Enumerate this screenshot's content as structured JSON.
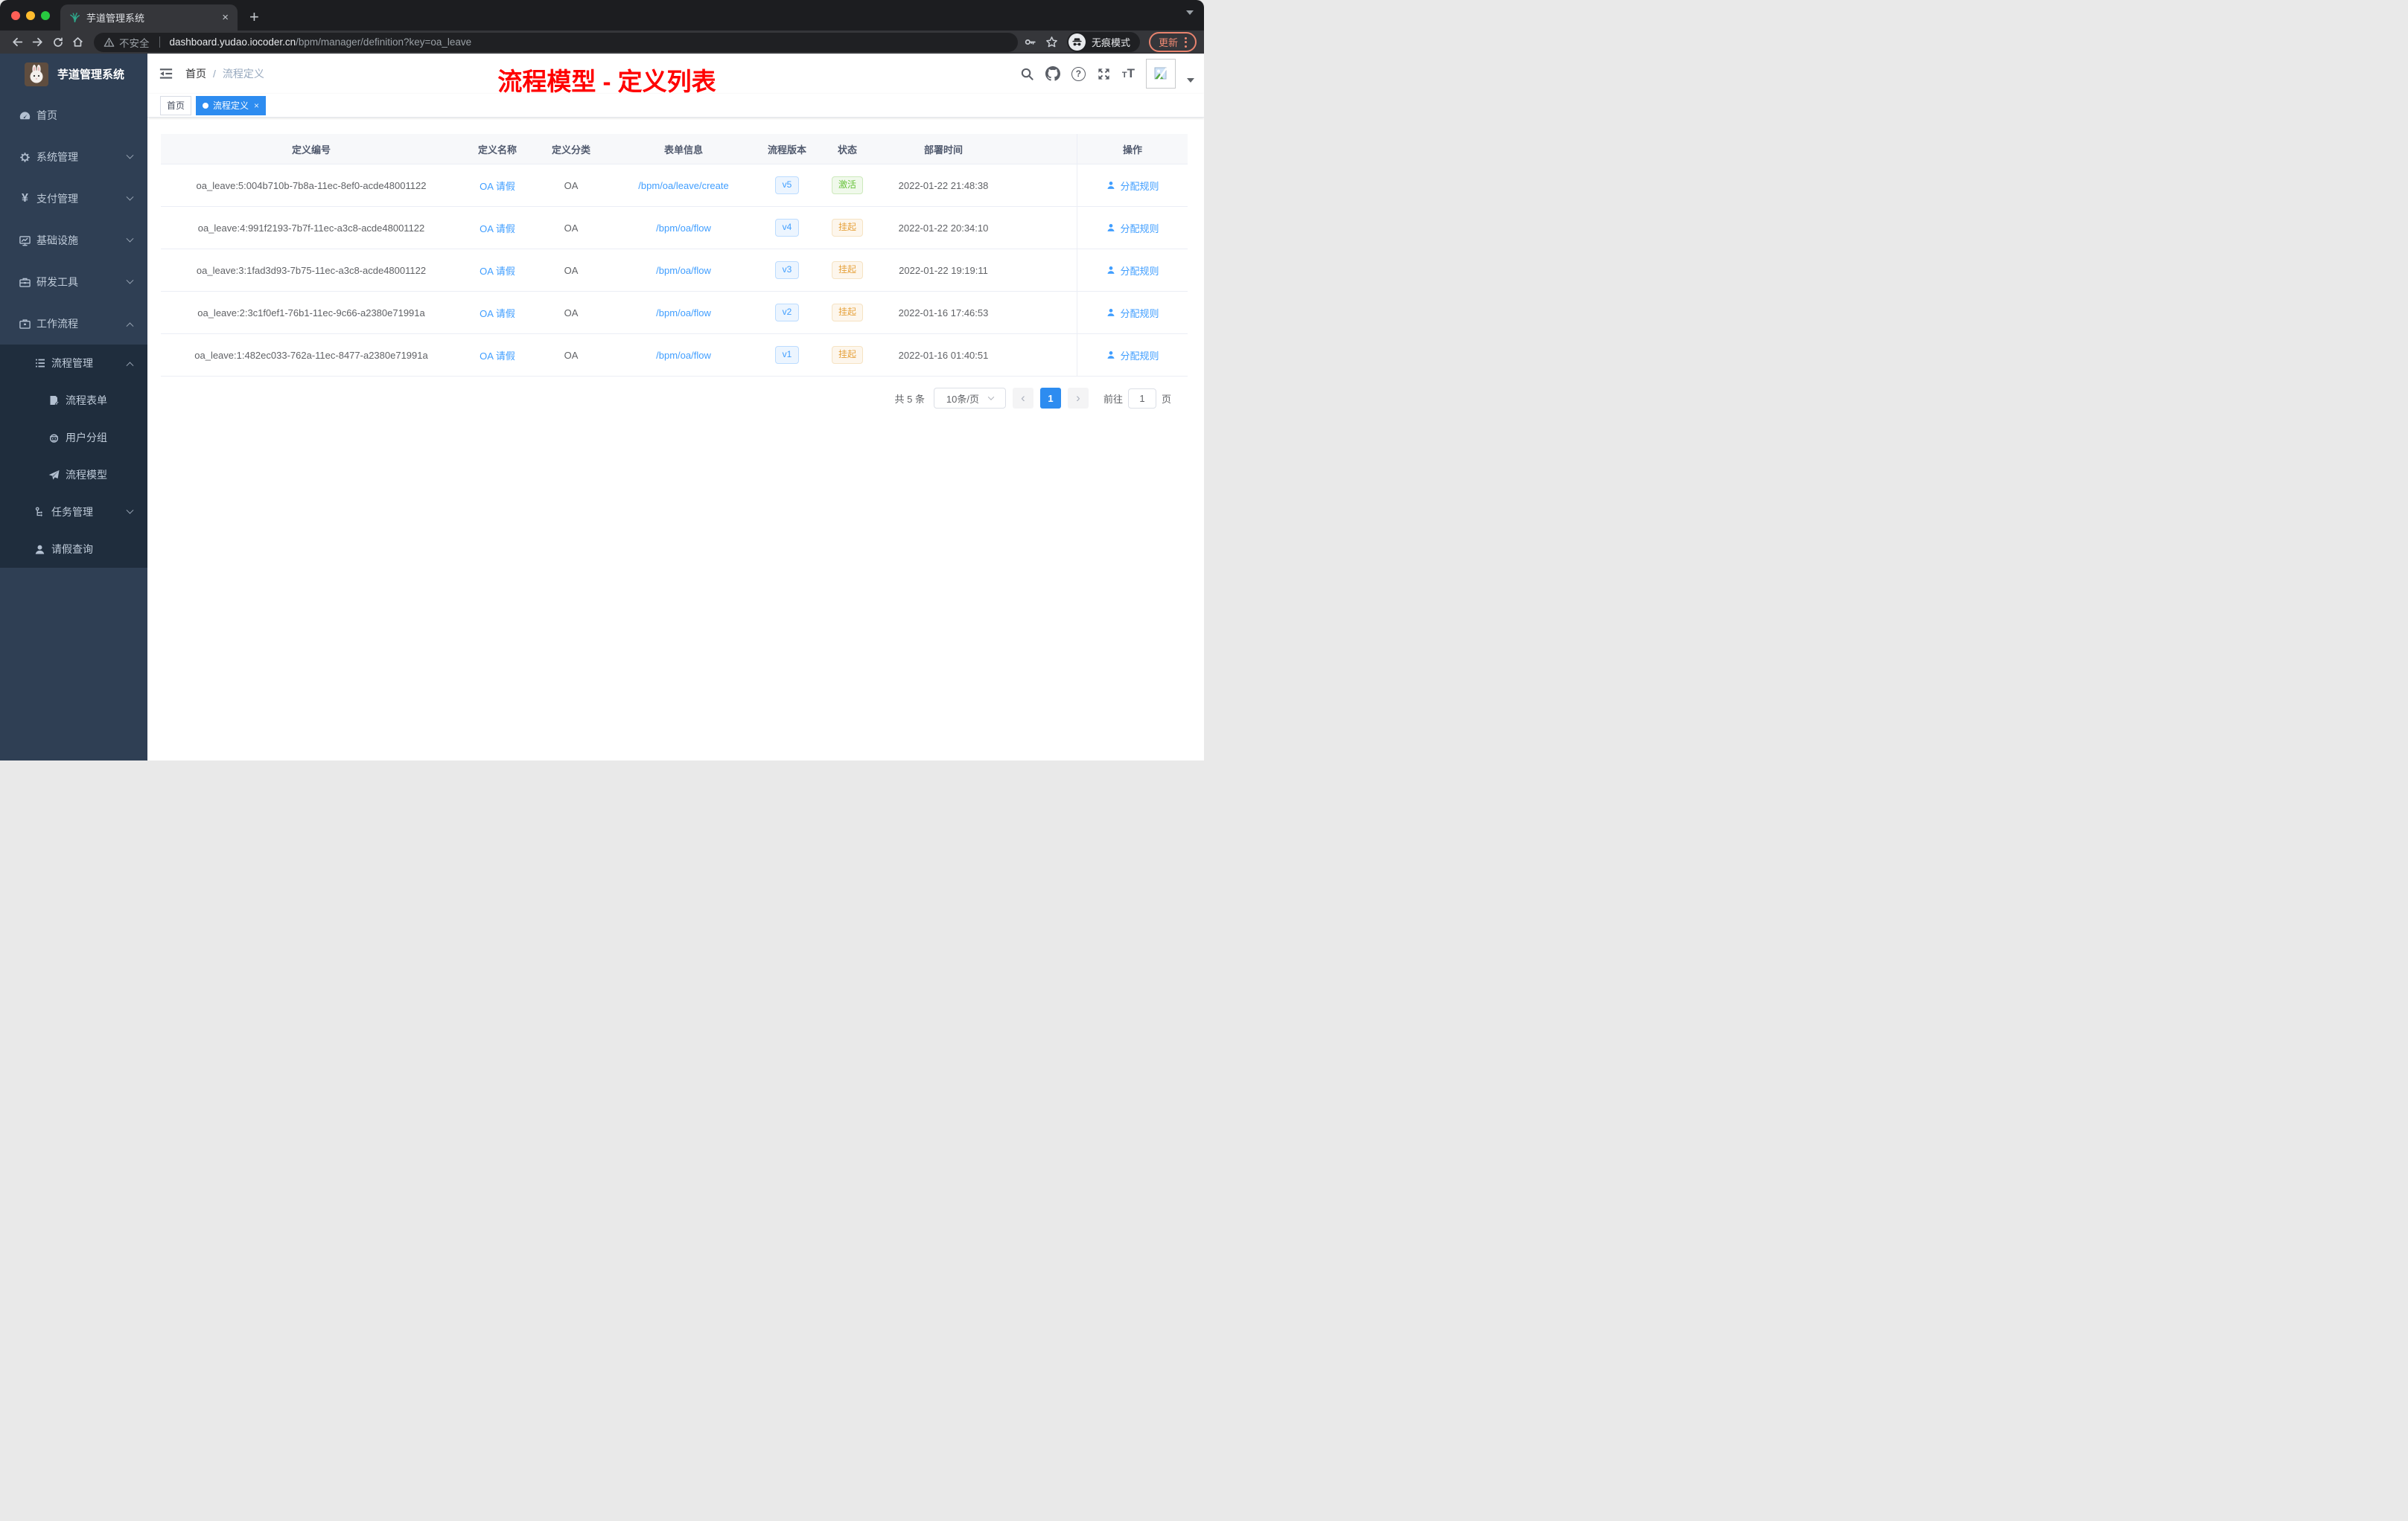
{
  "colors": {
    "accent": "#409eff",
    "tag_active": "#2d8cf0",
    "success": "#67c23a",
    "warning": "#e6a23c",
    "annotation": "#ff0000",
    "sidebar_bg": "#2f3f54",
    "submenu_bg": "#1f2d3d"
  },
  "browser": {
    "tab_title": "芋道管理系统",
    "close_tab": "×",
    "new_tab": "+",
    "not_secure": "不安全",
    "url_host": "dashboard.yudao.iocoder.cn",
    "url_path": "/bpm/manager/definition?key=oa_leave",
    "incognito": "无痕模式",
    "update": "更新"
  },
  "sidebar": {
    "app_title": "芋道管理系统",
    "items": [
      {
        "label": "首页",
        "icon": "dashboard-icon"
      },
      {
        "label": "系统管理",
        "icon": "gear-icon"
      },
      {
        "label": "支付管理",
        "icon": "yen-icon"
      },
      {
        "label": "基础设施",
        "icon": "monitor-icon"
      },
      {
        "label": "研发工具",
        "icon": "toolbox-icon"
      },
      {
        "label": "工作流程",
        "icon": "briefcase-icon"
      }
    ],
    "submenu": [
      {
        "label": "流程管理",
        "icon": "list-icon"
      },
      {
        "label": "流程表单",
        "icon": "form-icon"
      },
      {
        "label": "用户分组",
        "icon": "robot-icon"
      },
      {
        "label": "流程模型",
        "icon": "paper-plane-icon"
      },
      {
        "label": "任务管理",
        "icon": "tree-icon"
      },
      {
        "label": "请假查询",
        "icon": "user-icon"
      }
    ]
  },
  "header": {
    "breadcrumb_home": "首页",
    "breadcrumb_sep": "/",
    "breadcrumb_current": "流程定义",
    "annotation": "流程模型 - 定义列表"
  },
  "tags": [
    {
      "label": "首页",
      "active": false
    },
    {
      "label": "流程定义",
      "active": true,
      "close": "×"
    }
  ],
  "table": {
    "columns": [
      "定义编号",
      "定义名称",
      "定义分类",
      "表单信息",
      "流程版本",
      "状态",
      "部署时间",
      "操作"
    ],
    "rows": [
      {
        "id": "oa_leave:5:004b710b-7b8a-11ec-8ef0-acde48001122",
        "name": "OA 请假",
        "category": "OA",
        "form": "/bpm/oa/leave/create",
        "version": "v5",
        "status": "激活",
        "status_type": "success",
        "time": "2022-01-22 21:48:38",
        "action": "分配规则"
      },
      {
        "id": "oa_leave:4:991f2193-7b7f-11ec-a3c8-acde48001122",
        "name": "OA 请假",
        "category": "OA",
        "form": "/bpm/oa/flow",
        "version": "v4",
        "status": "挂起",
        "status_type": "warning",
        "time": "2022-01-22 20:34:10",
        "action": "分配规则"
      },
      {
        "id": "oa_leave:3:1fad3d93-7b75-11ec-a3c8-acde48001122",
        "name": "OA 请假",
        "category": "OA",
        "form": "/bpm/oa/flow",
        "version": "v3",
        "status": "挂起",
        "status_type": "warning",
        "time": "2022-01-22 19:19:11",
        "action": "分配规则"
      },
      {
        "id": "oa_leave:2:3c1f0ef1-76b1-11ec-9c66-a2380e71991a",
        "name": "OA 请假",
        "category": "OA",
        "form": "/bpm/oa/flow",
        "version": "v2",
        "status": "挂起",
        "status_type": "warning",
        "time": "2022-01-16 17:46:53",
        "action": "分配规则"
      },
      {
        "id": "oa_leave:1:482ec033-762a-11ec-8477-a2380e71991a",
        "name": "OA 请假",
        "category": "OA",
        "form": "/bpm/oa/flow",
        "version": "v1",
        "status": "挂起",
        "status_type": "warning",
        "time": "2022-01-16 01:40:51",
        "action": "分配规则"
      }
    ]
  },
  "pagination": {
    "total": "共 5 条",
    "page_size": "10条/页",
    "page": "1",
    "goto_label": "前往",
    "goto_value": "1",
    "goto_suffix": "页"
  }
}
